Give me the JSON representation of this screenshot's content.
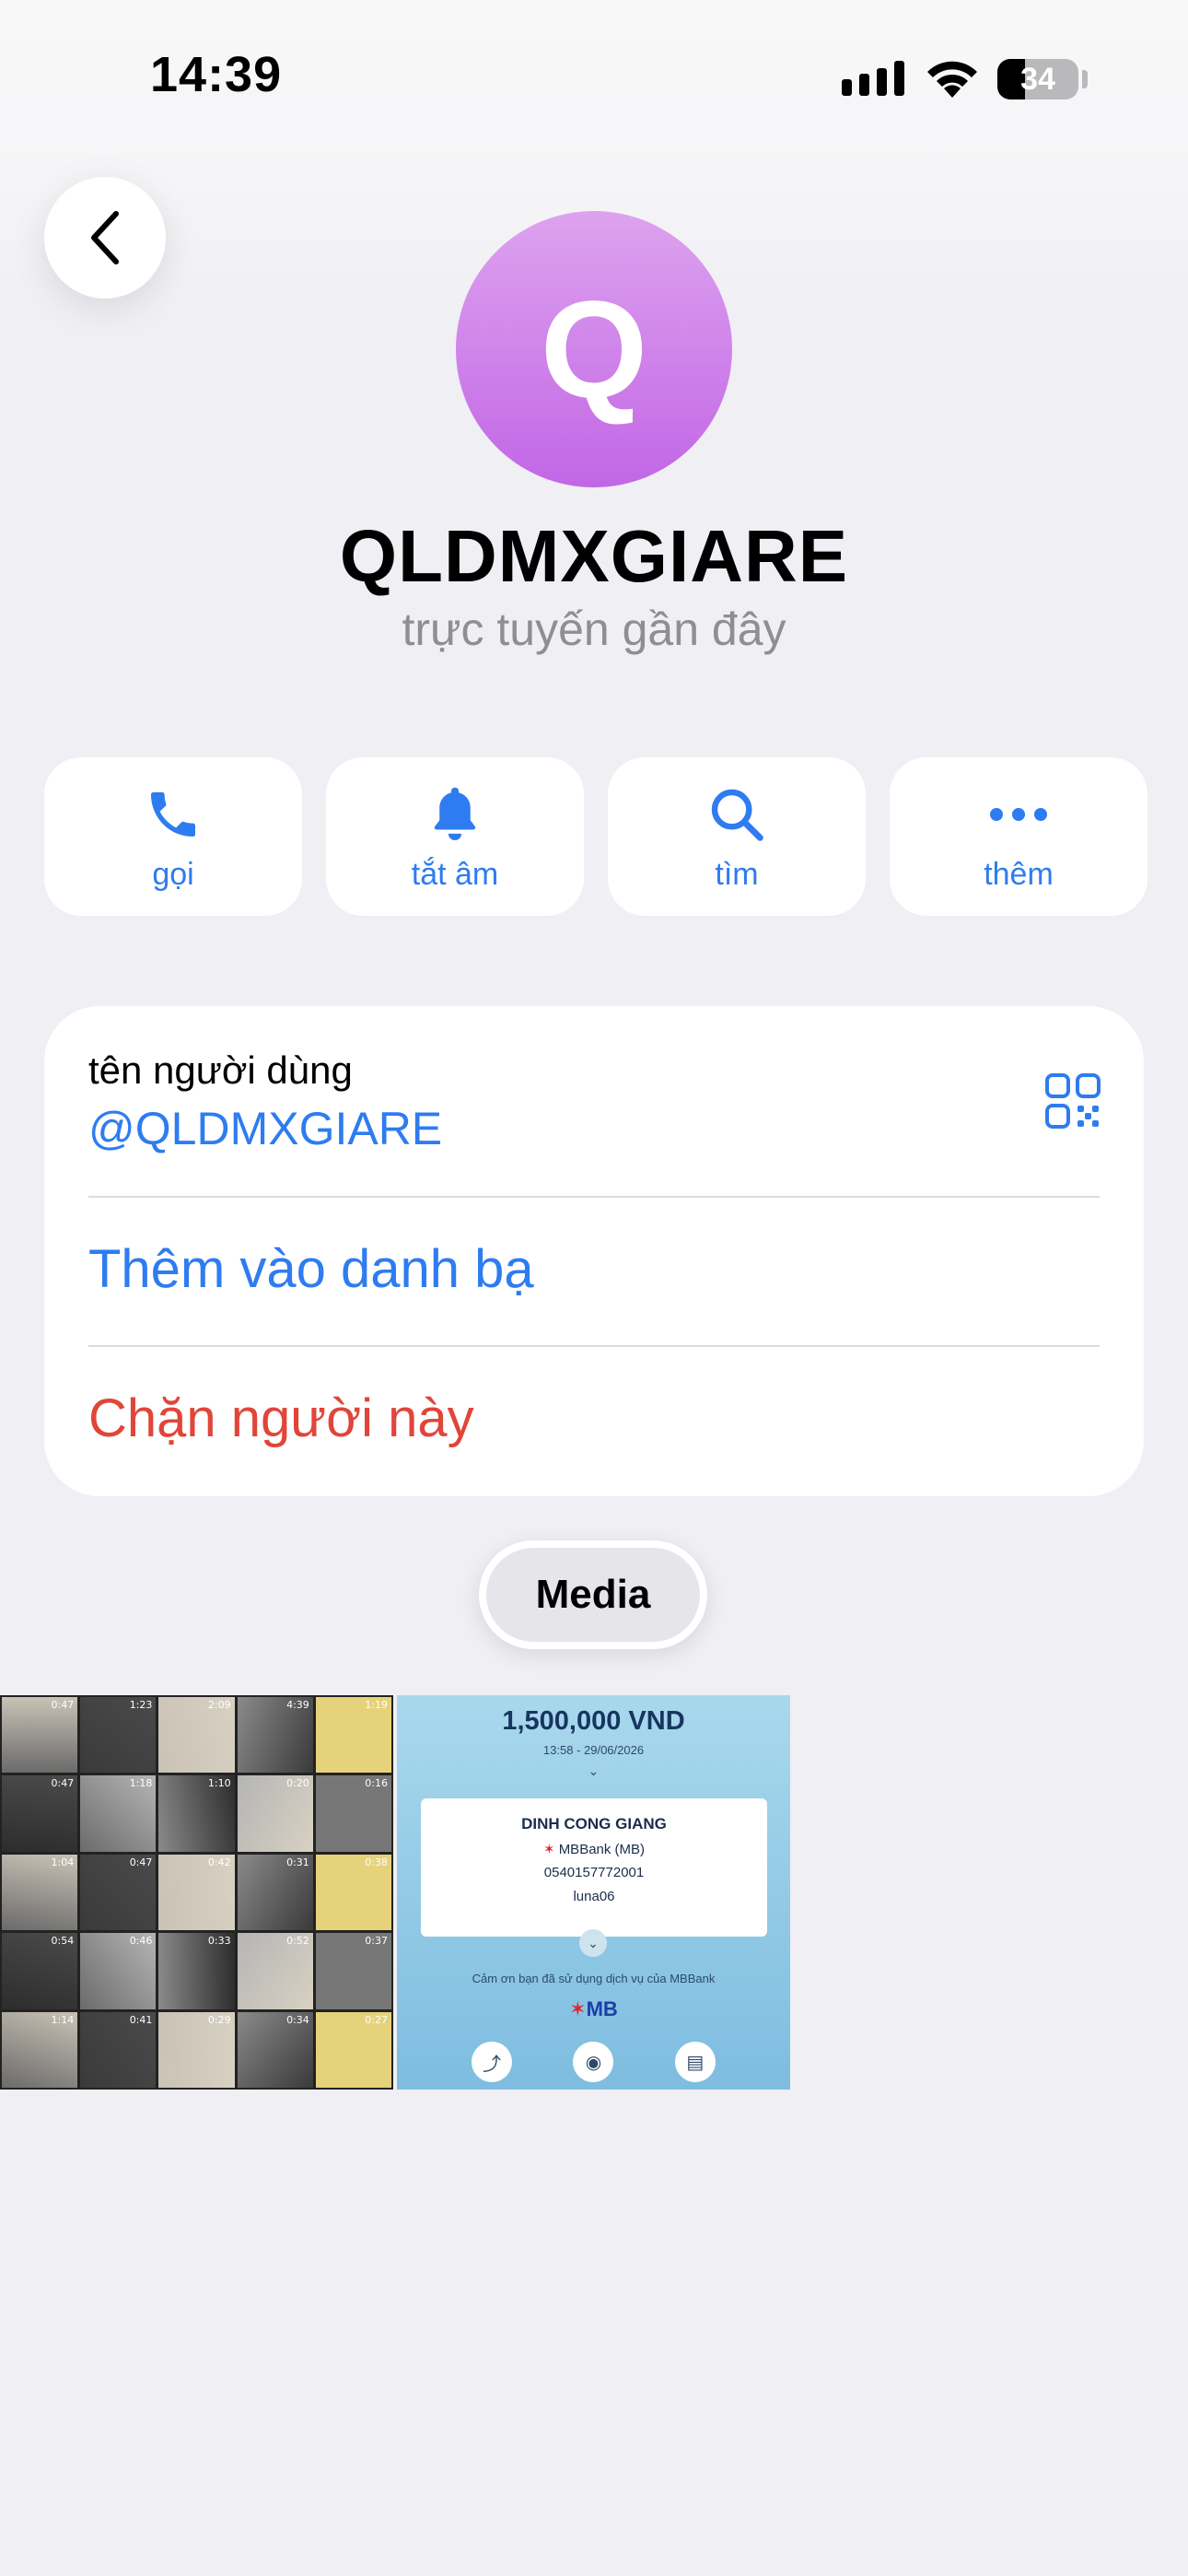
{
  "status_bar": {
    "time": "14:39",
    "battery": "34"
  },
  "profile": {
    "avatar_letter": "Q",
    "name": "QLDMXGIARE",
    "presence": "trực tuyến gần đây"
  },
  "actions": [
    {
      "label": "gọi",
      "icon": "phone-icon"
    },
    {
      "label": "tắt âm",
      "icon": "bell-icon"
    },
    {
      "label": "tìm",
      "icon": "search-icon"
    },
    {
      "label": "thêm",
      "icon": "more-icon"
    }
  ],
  "info_card": {
    "username_caption": "tên người dùng",
    "username_value": "@QLDMXGIARE",
    "add_contact": "Thêm vào danh bạ",
    "block_user": "Chặn người này"
  },
  "media_tab": {
    "label": "Media"
  },
  "media": {
    "collage_durations": [
      "0:47",
      "1:23",
      "2:09",
      "4:39",
      "1:19",
      "0:47",
      "1:18",
      "1:10",
      "0:20",
      "0:16",
      "1:04",
      "0:47",
      "0:42",
      "0:31",
      "0:38",
      "0:54",
      "0:46",
      "0:33",
      "0:52",
      "0:37",
      "1:14",
      "0:41",
      "0:29",
      "0:34",
      "0:27"
    ],
    "receipt": {
      "amount": "1,500,000 VND",
      "datetime": "13:58 - 29/06/2026",
      "recipient": "DINH CONG GIANG",
      "bank": "MBBank (MB)",
      "account": "0540157772001",
      "note": "luna06",
      "thanks": "Cảm ơn bạn đã sử dụng dịch vụ của MBBank",
      "logo": "MB"
    }
  },
  "colors": {
    "accent": "#2E7CF0",
    "danger": "#E1453A",
    "background": "#EFEFF4",
    "avatar_top": "#DDA3EE",
    "avatar_bottom": "#C266E6"
  }
}
